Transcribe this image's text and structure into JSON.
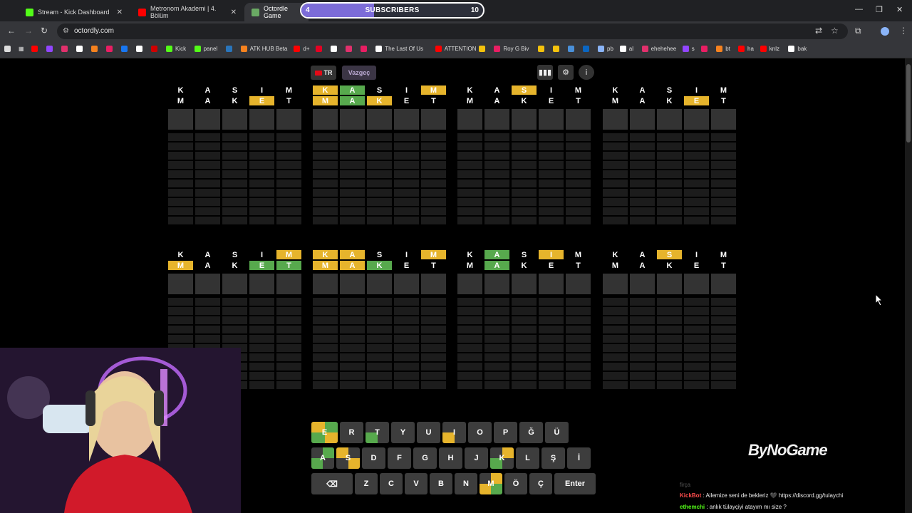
{
  "browser": {
    "tabs": [
      {
        "label": "Stream - Kick Dashboard",
        "color": "#53fc18"
      },
      {
        "label": "Metronom Akademi | 4. Bölüm",
        "color": "#ff0000"
      },
      {
        "label": "Octordle Game",
        "color": "#6aaa64"
      }
    ],
    "url": "octordly.com",
    "bookmarks": [
      {
        "label": "",
        "color": "#ff0000"
      },
      {
        "label": "",
        "color": "#9146ff"
      },
      {
        "label": "",
        "color": "#e1306c"
      },
      {
        "label": "",
        "color": "#ffffff"
      },
      {
        "label": "",
        "color": "#f6821f"
      },
      {
        "label": "",
        "color": "#e91e63"
      },
      {
        "label": "",
        "color": "#1877f2"
      },
      {
        "label": "",
        "color": "#ffffff"
      },
      {
        "label": "",
        "color": "#d00000"
      },
      {
        "label": "Kick",
        "color": "#53fc18"
      },
      {
        "label": "panel",
        "color": "#53fc18"
      },
      {
        "label": "",
        "color": "#2a75bb"
      },
      {
        "label": "ATK HUB Beta",
        "color": "#f6821f"
      },
      {
        "label": "d+",
        "color": "#ff0000"
      },
      {
        "label": "",
        "color": "#e60023"
      },
      {
        "label": "",
        "color": "#ffffff"
      },
      {
        "label": "",
        "color": "#e1306c"
      },
      {
        "label": "",
        "color": "#e91e63"
      },
      {
        "label": "The Last Of Us",
        "color": "#ffffff"
      },
      {
        "label": "ATTENTION",
        "color": "#ff0000"
      },
      {
        "label": "",
        "color": "#f4c20d"
      },
      {
        "label": "Roy G Biv",
        "color": "#e91e63"
      },
      {
        "label": "",
        "color": "#f4c20d"
      },
      {
        "label": "",
        "color": "#f4c20d"
      },
      {
        "label": "",
        "color": "#4a90d9"
      },
      {
        "label": "",
        "color": "#0a66c2"
      },
      {
        "label": "pb",
        "color": "#8ab4f8"
      },
      {
        "label": "al",
        "color": "#ffffff"
      },
      {
        "label": "ehehehee",
        "color": "#e1306c"
      },
      {
        "label": "s",
        "color": "#9146ff"
      },
      {
        "label": "",
        "color": "#e91e63"
      },
      {
        "label": "bt",
        "color": "#f6821f"
      },
      {
        "label": "ha",
        "color": "#ff0000"
      },
      {
        "label": "knlz",
        "color": "#ff0000"
      },
      {
        "label": "bak",
        "color": "#ffffff"
      }
    ]
  },
  "stream_overlay": {
    "title": "SUBSCRIBERS",
    "current": "4",
    "goal": "10",
    "progress": 0.4,
    "logo": "ByNoGame",
    "chat": [
      {
        "user": "",
        "message": "firça",
        "user_color": "#888888",
        "faded": true
      },
      {
        "user": "KickBot",
        "message": ": Ailemize seni de bekleriz 🖤 https://discord.gg/tulaychi",
        "user_color": "#ff4d4d"
      },
      {
        "user": "ethemchi",
        "message": ": anlık tülayçiyi atayım mı size ?",
        "user_color": "#53fc18"
      }
    ]
  },
  "game": {
    "language": "TR",
    "giveup_label": "Vazgeç",
    "colors": {
      "yellow": "#e6b42c",
      "green": "#57a94d",
      "key": "#3d3d3d",
      "cell": "#333333"
    },
    "guesses": [
      "KASIM",
      "MAKET"
    ],
    "boards": [
      {
        "rows": [
          [
            "",
            "",
            "",
            "",
            ""
          ],
          [
            "",
            "",
            "",
            "y",
            ""
          ]
        ]
      },
      {
        "rows": [
          [
            "y",
            "g",
            "",
            "",
            "y"
          ],
          [
            "y",
            "g",
            "y",
            "",
            ""
          ]
        ]
      },
      {
        "rows": [
          [
            "",
            "",
            "y",
            "",
            ""
          ],
          [
            "",
            "",
            "",
            "",
            ""
          ]
        ]
      },
      {
        "rows": [
          [
            "",
            "",
            "",
            "",
            ""
          ],
          [
            "",
            "",
            "",
            "y",
            ""
          ]
        ]
      },
      {
        "rows": [
          [
            "",
            "",
            "",
            "",
            "y"
          ],
          [
            "y",
            "",
            "",
            "g",
            "g"
          ]
        ]
      },
      {
        "rows": [
          [
            "y",
            "y",
            "",
            "",
            "y"
          ],
          [
            "y",
            "y",
            "g",
            "",
            ""
          ]
        ]
      },
      {
        "rows": [
          [
            "",
            "g",
            "",
            "y",
            ""
          ],
          [
            "",
            "g",
            "",
            "",
            ""
          ]
        ]
      },
      {
        "rows": [
          [
            "",
            "",
            "y",
            "",
            ""
          ],
          [
            "",
            "",
            "",
            "",
            ""
          ]
        ]
      }
    ],
    "keyboard": [
      [
        {
          "k": "E",
          "w": 37,
          "q": [
            "y",
            "g",
            "g",
            "y"
          ]
        },
        {
          "k": "R",
          "w": 33
        },
        {
          "k": "T",
          "w": 33,
          "q": [
            "",
            "",
            "g",
            ""
          ]
        },
        {
          "k": "Y",
          "w": 33
        },
        {
          "k": "U",
          "w": 33
        },
        {
          "k": "I",
          "w": 33,
          "q": [
            "",
            "",
            "y",
            ""
          ]
        },
        {
          "k": "O",
          "w": 33
        },
        {
          "k": "P",
          "w": 33
        },
        {
          "k": "Ğ",
          "w": 33
        },
        {
          "k": "Ü",
          "w": 33
        }
      ],
      [
        {
          "k": "A",
          "w": 32,
          "q": [
            "",
            "g",
            "g",
            ""
          ]
        },
        {
          "k": "S",
          "w": 33,
          "q": [
            "y",
            "",
            "",
            "y"
          ]
        },
        {
          "k": "D",
          "w": 33
        },
        {
          "k": "F",
          "w": 33
        },
        {
          "k": "G",
          "w": 33
        },
        {
          "k": "H",
          "w": 33
        },
        {
          "k": "J",
          "w": 33
        },
        {
          "k": "K",
          "w": 33,
          "q": [
            "",
            "y",
            "g",
            ""
          ]
        },
        {
          "k": "L",
          "w": 33
        },
        {
          "k": "Ş",
          "w": 33
        },
        {
          "k": "İ",
          "w": 33
        }
      ],
      [
        {
          "k": "⌫",
          "w": 58,
          "icon": "backspace-icon"
        },
        {
          "k": "Z",
          "w": 32
        },
        {
          "k": "C",
          "w": 32
        },
        {
          "k": "V",
          "w": 32
        },
        {
          "k": "B",
          "w": 32
        },
        {
          "k": "N",
          "w": 32
        },
        {
          "k": "M",
          "w": 32,
          "q": [
            "",
            "y",
            "y",
            "g"
          ]
        },
        {
          "k": "Ö",
          "w": 32
        },
        {
          "k": "Ç",
          "w": 32
        },
        {
          "k": "Enter",
          "w": 58
        }
      ]
    ]
  }
}
